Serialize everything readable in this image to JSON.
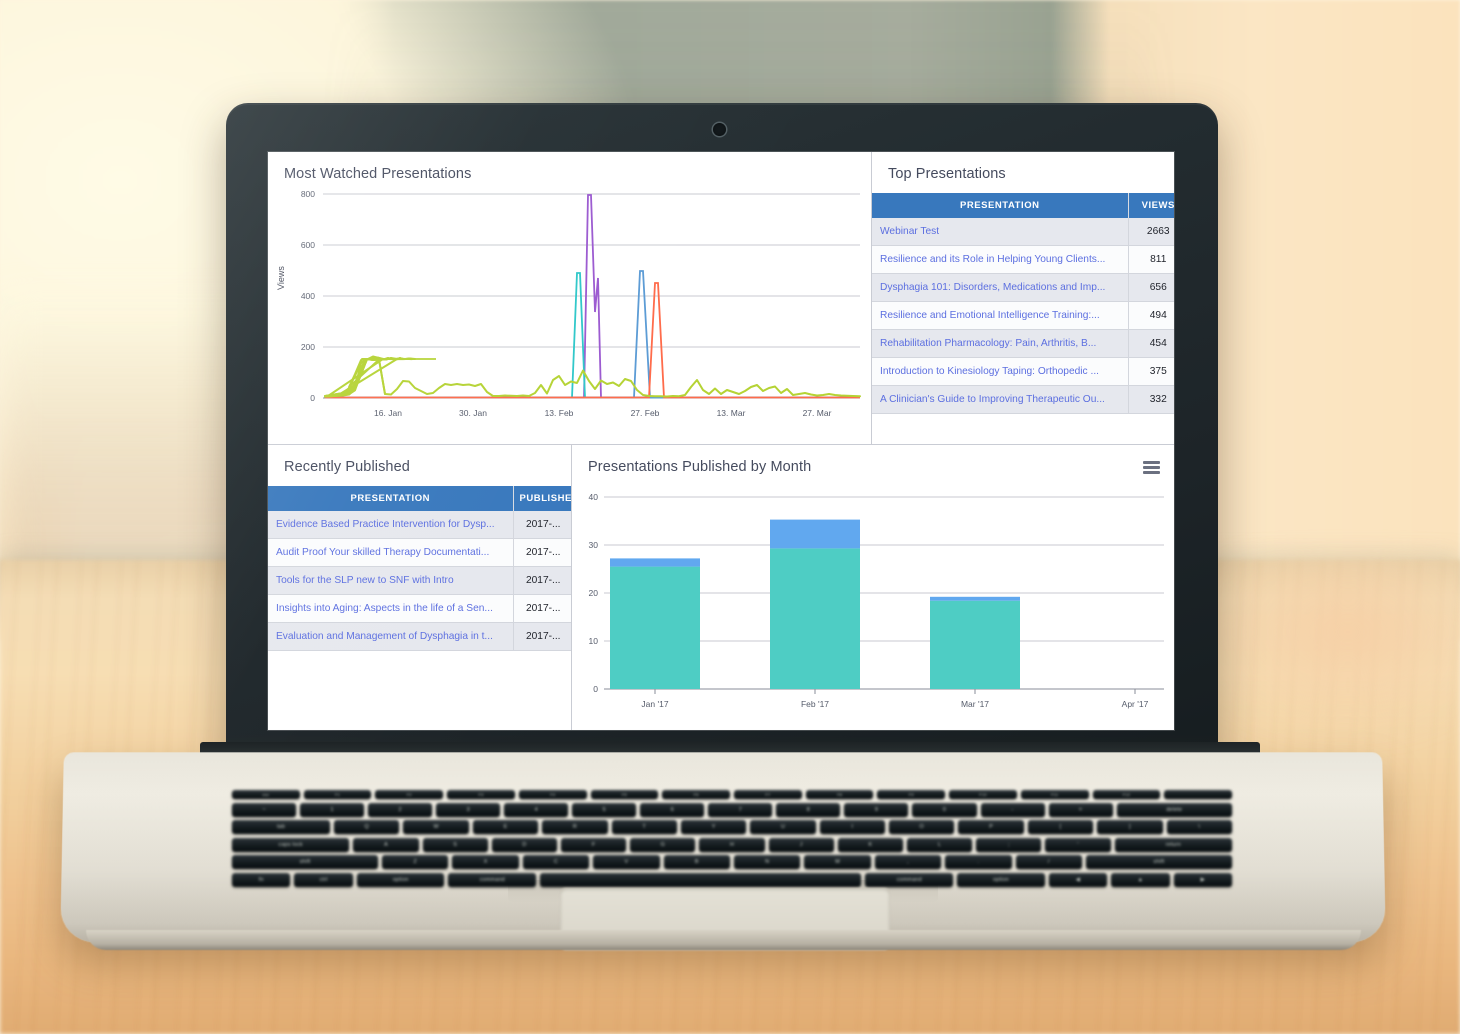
{
  "dashboard": {
    "panels": {
      "most_watched": {
        "title": "Most Watched Presentations"
      },
      "top_presentations": {
        "title": "Top Presentations",
        "columns": [
          "PRESENTATION",
          "VIEWS"
        ],
        "rows": [
          {
            "presentation": "Webinar Test",
            "views": "2663"
          },
          {
            "presentation": "Resilience and its Role in Helping Young Clients...",
            "views": "811"
          },
          {
            "presentation": "Dysphagia 101: Disorders, Medications and Imp...",
            "views": "656"
          },
          {
            "presentation": "Resilience and Emotional Intelligence Training:...",
            "views": "494"
          },
          {
            "presentation": "Rehabilitation Pharmacology: Pain, Arthritis, B...",
            "views": "454"
          },
          {
            "presentation": "Introduction to Kinesiology Taping: Orthopedic ...",
            "views": "375"
          },
          {
            "presentation": "A Clinician's Guide to Improving Therapeutic Ou...",
            "views": "332"
          }
        ]
      },
      "recently_published": {
        "title": "Recently Published",
        "columns": [
          "PRESENTATION",
          "PUBLISHED"
        ],
        "rows": [
          {
            "presentation": "Evidence Based Practice Intervention for Dysp...",
            "published": "2017-..."
          },
          {
            "presentation": "Audit Proof Your skilled Therapy Documentati...",
            "published": "2017-..."
          },
          {
            "presentation": "Tools for the SLP new to SNF with Intro",
            "published": "2017-..."
          },
          {
            "presentation": "Insights into Aging: Aspects in the life of a Sen...",
            "published": "2017-..."
          },
          {
            "presentation": "Evaluation and Management of Dysphagia in t...",
            "published": "2017-..."
          }
        ]
      },
      "published_by_month": {
        "title": "Presentations Published by Month",
        "menu_icon": "hamburger-menu-icon"
      }
    }
  },
  "colors": {
    "header_blue": "#3878bd",
    "link_blue": "#5c6fe0",
    "bar_teal": "#4ecdc4",
    "bar_blue": "#61a8ef",
    "line_green": "#b5d334",
    "line_purple": "#9b59d0",
    "line_teal": "#2ec7c9",
    "line_blue": "#5b9bd5",
    "line_orange": "#ff6b4a"
  },
  "chart_data": [
    {
      "id": "most-watched-line-chart",
      "type": "line",
      "title": "Most Watched Presentations",
      "xlabel": "",
      "ylabel": "Views",
      "ylim": [
        0,
        800
      ],
      "yticks": [
        0,
        200,
        400,
        600,
        800
      ],
      "xticks": [
        "16. Jan",
        "30. Jan",
        "13. Feb",
        "27. Feb",
        "13. Mar",
        "27. Mar"
      ],
      "grid": true,
      "legend": "none",
      "series": [
        {
          "name": "Series A (green)",
          "color": "#b5d334",
          "values": [
            5,
            6,
            8,
            10,
            12,
            40,
            95,
            150,
            80,
            95,
            10,
            8,
            35,
            65,
            55,
            20,
            8,
            30,
            52,
            50,
            28,
            45,
            55,
            50,
            55,
            18,
            5,
            8,
            10,
            6,
            8,
            6,
            5,
            35,
            60,
            22,
            48,
            95,
            105,
            60,
            80,
            45,
            110,
            55,
            125,
            58,
            30,
            60,
            48,
            55,
            35,
            70,
            65,
            20,
            8,
            10,
            6,
            5,
            6,
            5,
            8,
            28,
            55,
            20,
            12,
            25,
            8,
            22,
            18,
            10,
            18,
            30,
            35,
            18,
            28,
            32,
            12,
            20,
            8,
            10,
            12,
            8,
            6,
            8
          ]
        },
        {
          "name": "Series B (purple)",
          "color": "#9b59d0",
          "peak_value": 790,
          "peak_date": "approx 19. Feb"
        },
        {
          "name": "Series C (teal)",
          "color": "#2ec7c9",
          "peak_value": 490,
          "peak_date": "approx 17. Feb"
        },
        {
          "name": "Series D (blue)",
          "color": "#5b9bd5",
          "peak_value": 497,
          "peak_date": "approx 26. Feb"
        },
        {
          "name": "Series E (orange)",
          "color": "#ff6b4a",
          "peak_value": 450,
          "peak_date": "approx 28. Feb"
        }
      ]
    },
    {
      "id": "published-by-month-bar-chart",
      "type": "bar",
      "stacked": true,
      "title": "Presentations Published by Month",
      "xlabel": "",
      "ylabel": "",
      "ylim": [
        0,
        40
      ],
      "yticks": [
        0,
        10,
        20,
        30,
        40
      ],
      "categories": [
        "Jan '17",
        "Feb '17",
        "Mar '17",
        "Apr '17"
      ],
      "grid": true,
      "legend": "none",
      "series": [
        {
          "name": "Published (teal)",
          "color": "#4ecdc4",
          "values": [
            25.5,
            29.3,
            18.4,
            0
          ]
        },
        {
          "name": "Additional (blue)",
          "color": "#61a8ef",
          "values": [
            1.7,
            6.0,
            0.8,
            0
          ]
        }
      ],
      "totals": [
        27.2,
        35.3,
        19.2,
        0
      ]
    }
  ],
  "device": {
    "keyboard": {
      "fn_row": [
        "esc",
        "F1",
        "F2",
        "F3",
        "F4",
        "F5",
        "F6",
        "F7",
        "F8",
        "F9",
        "F10",
        "F11",
        "F12",
        ""
      ],
      "row1": [
        "~",
        "1",
        "2",
        "3",
        "4",
        "5",
        "6",
        "7",
        "8",
        "9",
        "0",
        "-",
        "=",
        "delete"
      ],
      "row2": [
        "tab",
        "Q",
        "W",
        "E",
        "R",
        "T",
        "Y",
        "U",
        "I",
        "O",
        "P",
        "[",
        "]",
        "\\"
      ],
      "row3": [
        "caps lock",
        "A",
        "S",
        "D",
        "F",
        "G",
        "H",
        "J",
        "K",
        "L",
        ";",
        "'",
        "return"
      ],
      "row4": [
        "shift",
        "Z",
        "X",
        "C",
        "V",
        "B",
        "N",
        "M",
        ",",
        ".",
        "/",
        "shift"
      ],
      "row5": [
        "fn",
        "ctrl",
        "option",
        "command",
        "",
        "command",
        "option",
        "◀",
        "▲",
        "▶"
      ]
    }
  }
}
